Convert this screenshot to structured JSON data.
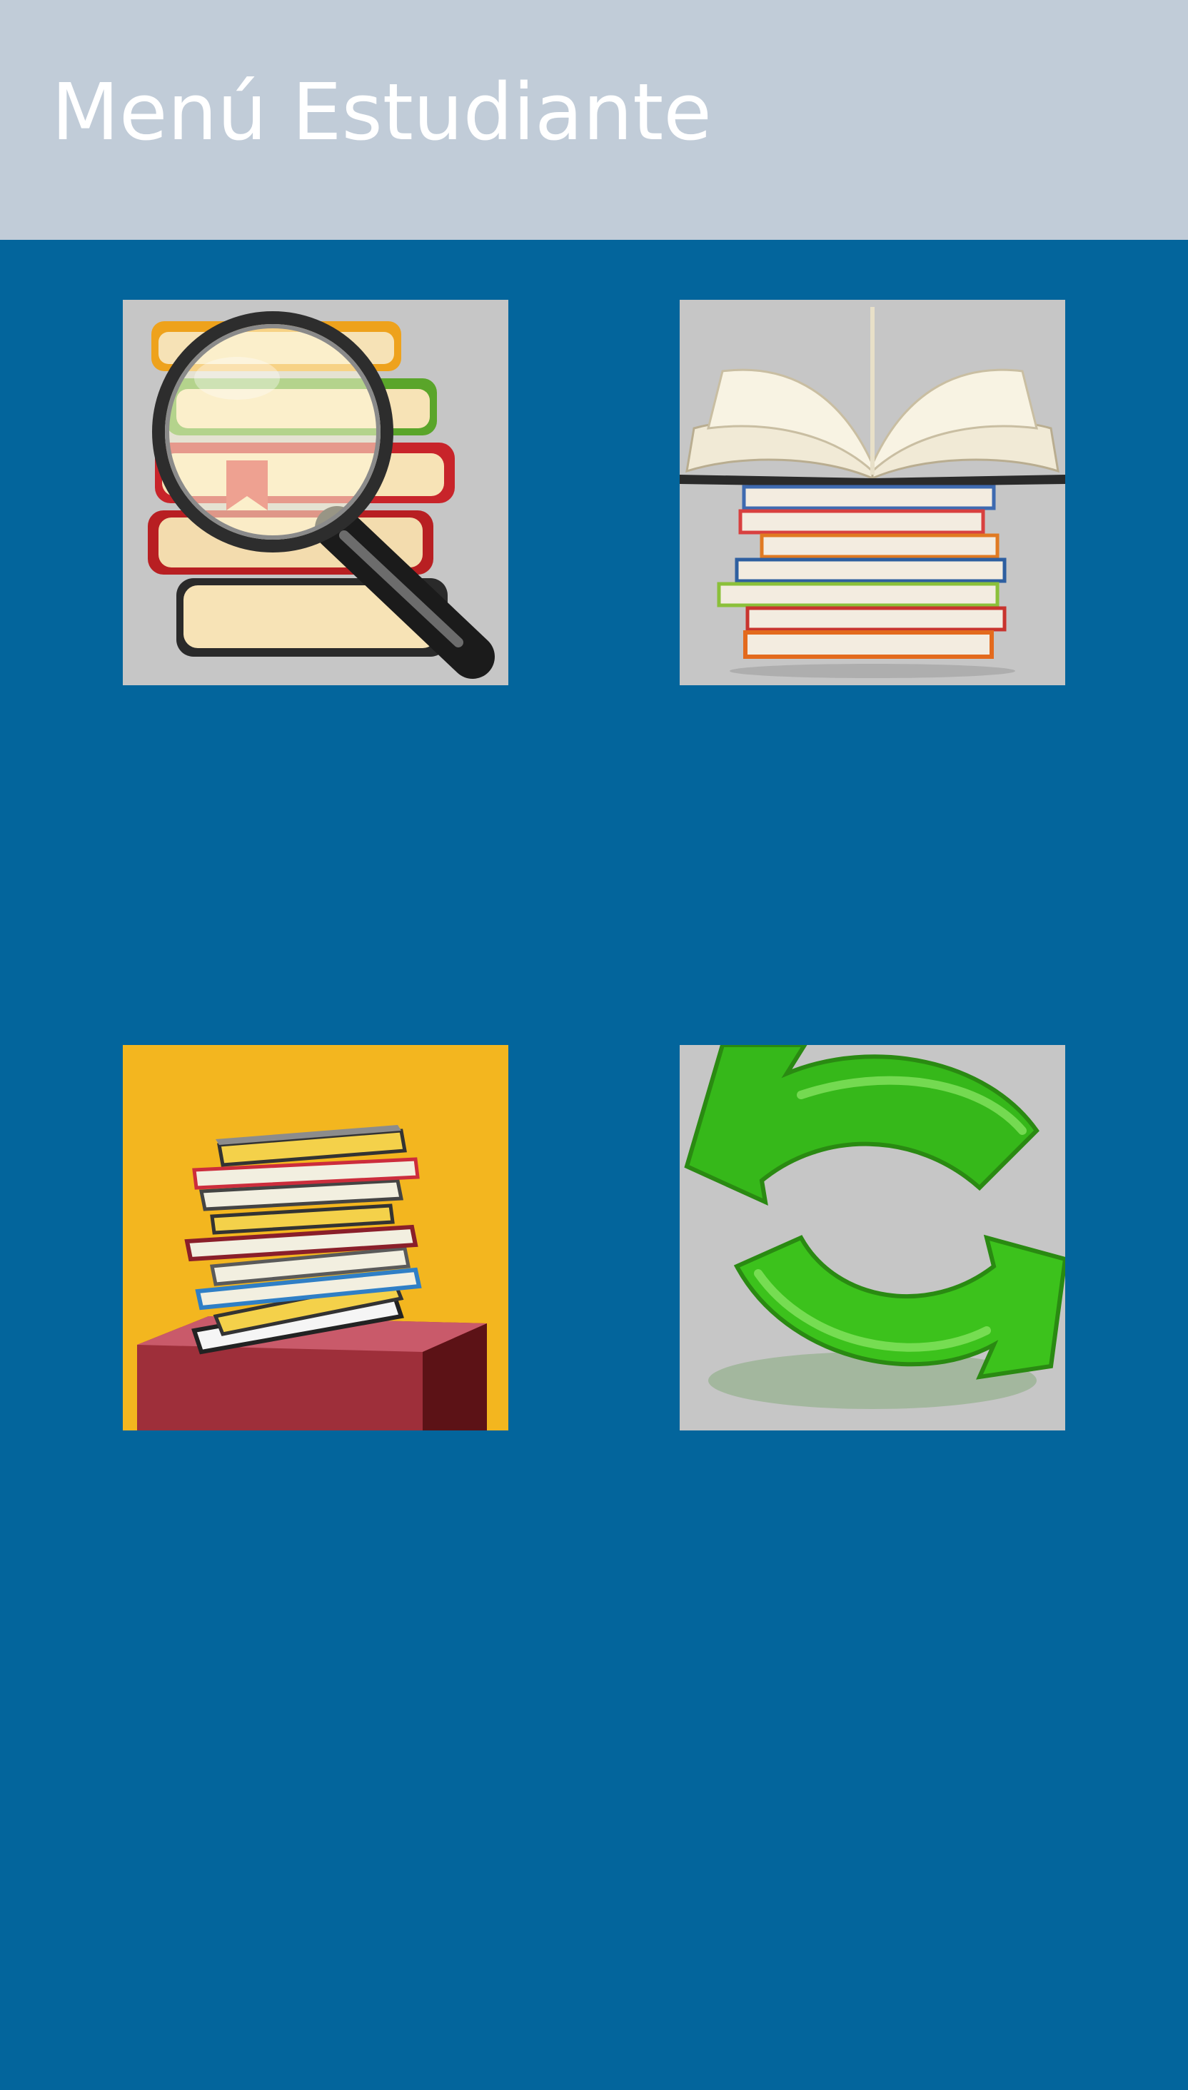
{
  "app_bar": {
    "title": "Menú Estudiante",
    "background": "#c1ccd8",
    "title_color": "#ffffff"
  },
  "main": {
    "background": "#03659c",
    "tiles": [
      {
        "id": "search-books",
        "icon": "magnifier-books-icon"
      },
      {
        "id": "open-book",
        "icon": "open-book-stack-icon"
      },
      {
        "id": "book-stack",
        "icon": "book-stack-pedestal-icon"
      },
      {
        "id": "refresh",
        "icon": "refresh-arrows-icon"
      }
    ]
  },
  "colors": {
    "tile_gray": "#c8c8c8",
    "tile_yellow": "#f3b61f",
    "arrow_green": "#3dc21a"
  }
}
